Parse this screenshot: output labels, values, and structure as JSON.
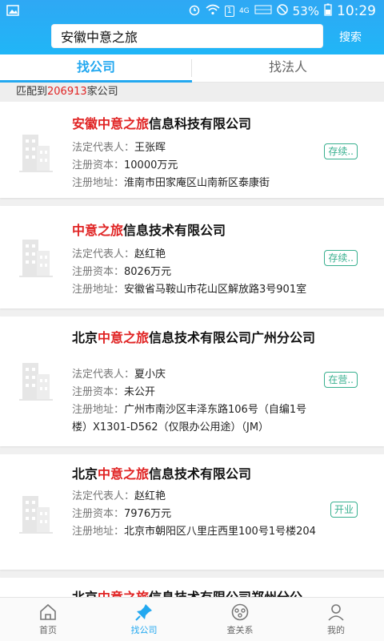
{
  "status_bar": {
    "network": "4G",
    "battery": "53%",
    "time": "10:29"
  },
  "search": {
    "value": "安徽中意之旅",
    "button": "搜索"
  },
  "tabs": [
    "找公司",
    "找法人"
  ],
  "match": {
    "prefix": "匹配到",
    "count": "206913",
    "suffix": "家公司"
  },
  "labels": {
    "legal_rep": "法定代表人：",
    "capital": "注册资本：",
    "address": "注册地址："
  },
  "companies": [
    {
      "title_pre": "",
      "title_hl": "安徽中意之旅",
      "title_post": "信息科技有限公司",
      "legal_rep": "王张晖",
      "capital": "10000万元",
      "address": "淮南市田家庵区山南新区泰康街",
      "status": "存续.."
    },
    {
      "title_pre": "",
      "title_hl": "中意之旅",
      "title_post": "信息技术有限公司",
      "legal_rep": "赵红艳",
      "capital": "8026万元",
      "address": "安徽省马鞍山市花山区解放路3号901室",
      "status": "存续.."
    },
    {
      "title_pre": "北京",
      "title_hl": "中意之旅",
      "title_post": "信息技术有限公司广州分公司",
      "legal_rep": "夏小庆",
      "capital": "未公开",
      "address": "广州市南沙区丰泽东路106号（自编1号楼）X1301-D562（仅限办公用途）（JM）",
      "status": "在营.."
    },
    {
      "title_pre": "北京",
      "title_hl": "中意之旅",
      "title_post": "信息技术有限公司",
      "legal_rep": "赵红艳",
      "capital": "7976万元",
      "address": "北京市朝阳区八里庄西里100号1号楼204",
      "status": "开业"
    },
    {
      "title_pre": "北京",
      "title_hl": "中意之旅",
      "title_post": "信息技术有限公司郑州分公",
      "legal_rep": "",
      "capital": "",
      "address": "",
      "status": ""
    }
  ],
  "bottom_nav": [
    "首页",
    "找公司",
    "查关系",
    "我的"
  ],
  "colors": {
    "accent": "#22a8f0",
    "highlight": "#e02424",
    "status_green": "#38b08f"
  }
}
